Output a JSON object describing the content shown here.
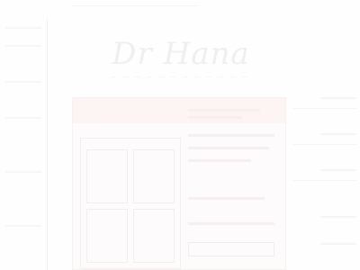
{
  "brand": {
    "logo_text": "Dr Hana",
    "tagline": "— — — — — — — — — — — —"
  },
  "colors": {
    "background": "#fefefe",
    "panel": "#fdfbfb",
    "accent": "#fdf5f3"
  }
}
